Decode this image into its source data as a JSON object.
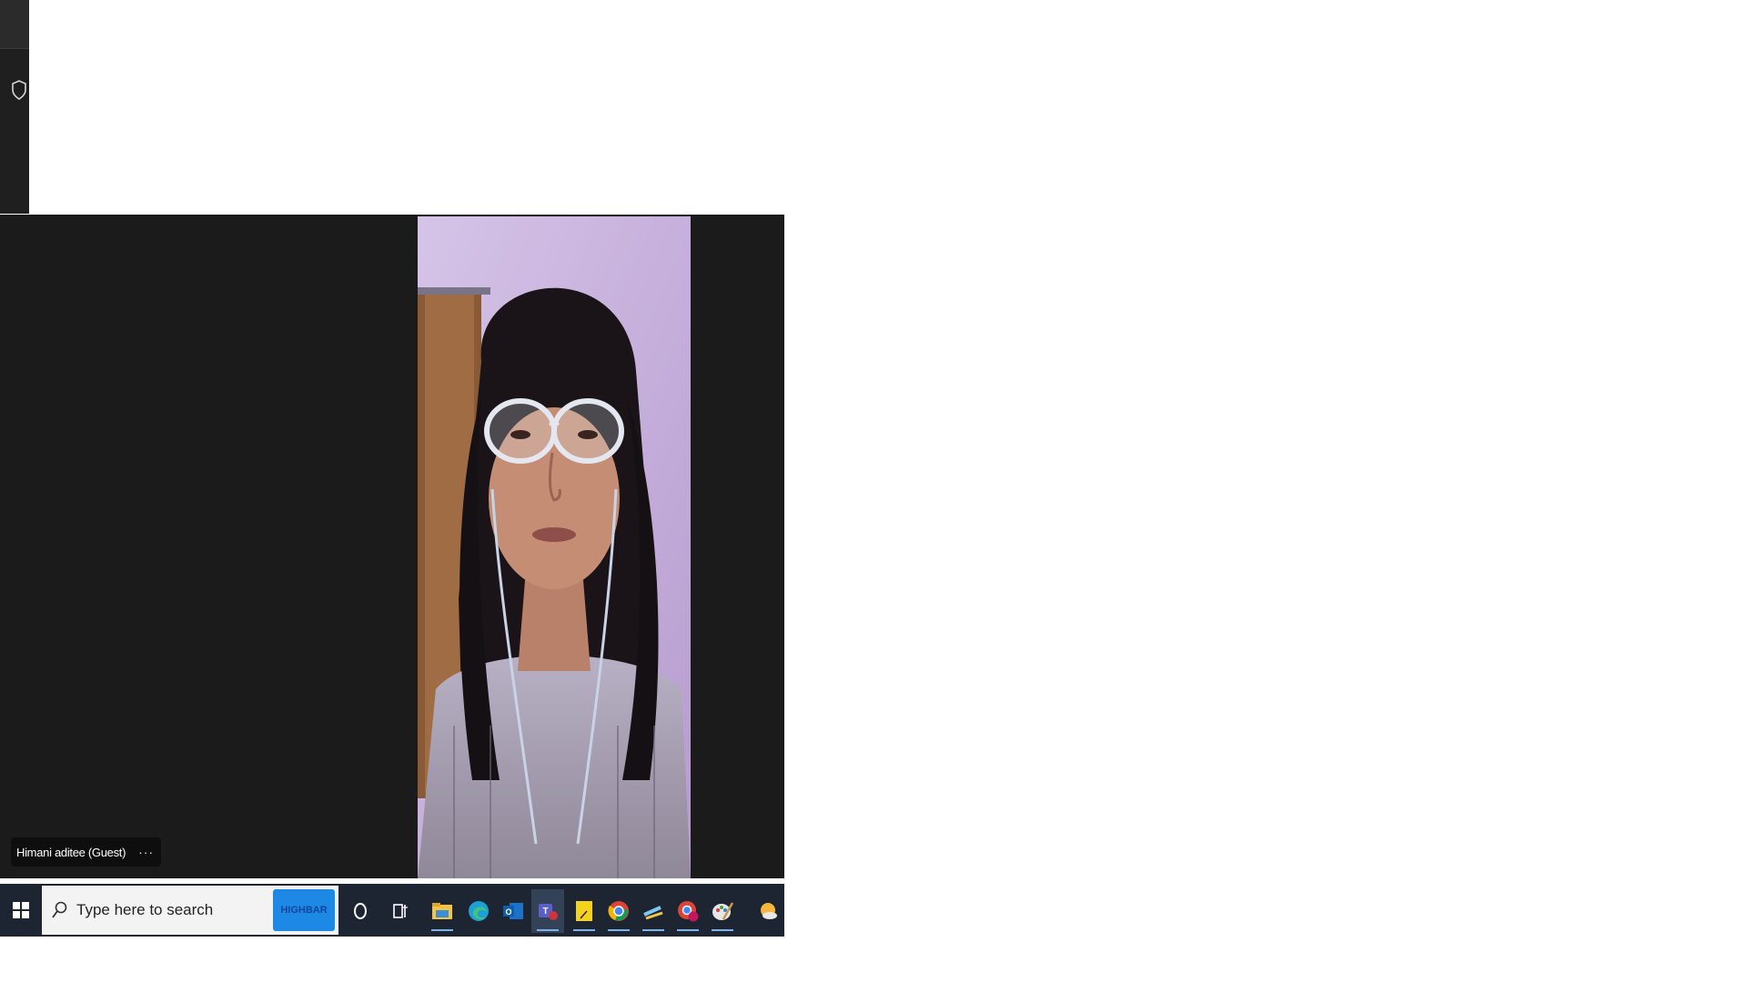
{
  "participant": {
    "name": "Himani aditee (Guest)",
    "more_label": "···"
  },
  "taskbar": {
    "search_placeholder": "Type here to search",
    "search_badge": "HIGHBAR",
    "icons": [
      {
        "name": "cortana-icon"
      },
      {
        "name": "task-view-icon"
      },
      {
        "name": "file-explorer-icon"
      },
      {
        "name": "edge-icon"
      },
      {
        "name": "outlook-icon"
      },
      {
        "name": "teams-icon"
      },
      {
        "name": "sticky-notes-icon"
      },
      {
        "name": "chrome-icon"
      },
      {
        "name": "app-icon"
      },
      {
        "name": "chrome-profile-icon"
      },
      {
        "name": "paint-icon"
      },
      {
        "name": "weather-icon"
      }
    ]
  },
  "colors": {
    "stage_bg": "#1b1b1b",
    "taskbar_bg": "#1c2531",
    "accent": "#1e88e5"
  }
}
